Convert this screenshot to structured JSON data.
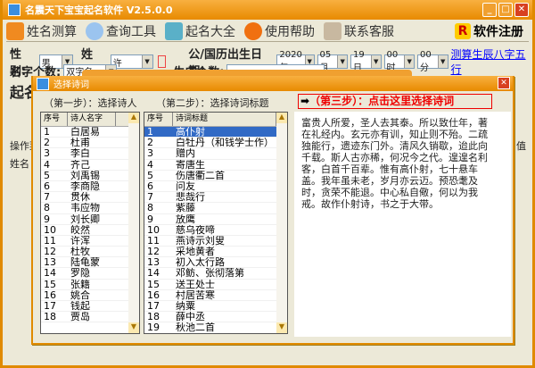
{
  "app": {
    "title": "名震天下宝宝起名软件 V2.5.0.0"
  },
  "toolbar": {
    "items": [
      "姓名测算",
      "查询工具",
      "起名大全",
      "使用帮助",
      "联系客服"
    ],
    "register": "软件注册"
  },
  "form": {
    "gender_label": "性别:",
    "gender": "男",
    "surname_label": "姓氏:",
    "surname": "许",
    "birth_label": "公/国历出生日期:",
    "year": "2020年",
    "month": "05月",
    "day": "19日",
    "hour": "00时",
    "minute": "00分",
    "bazi_link": "测算生辰八字五行",
    "count_label": "名字个数:",
    "count": "双字名",
    "gen_label": "生成个数:"
  },
  "background": {
    "heading": "起名",
    "menu": "操作菜",
    "col_name": "姓名",
    "col_value": "值"
  },
  "dialog": {
    "title": "选择诗词",
    "step1": "（第一步）：选择诗人",
    "step2": "（第二步）：选择诗词标题",
    "step3": "（第三步）：点击这里选择诗词",
    "poets_headers": [
      "序号",
      "诗人名字"
    ],
    "poets": [
      "白居易",
      "杜甫",
      "李白",
      "齐己",
      "刘禹锡",
      "李商隐",
      "贯休",
      "韦应物",
      "刘长卿",
      "皎然",
      "许浑",
      "杜牧",
      "陆龟蒙",
      "罗隐",
      "张籍",
      "姚合",
      "钱起",
      "贾岛"
    ],
    "titles_headers": [
      "序号",
      "诗词标题"
    ],
    "titles": [
      "高仆射",
      "白牡丹（和钱学士作）",
      "赠内",
      "寄唐生",
      "伤唐衢二首",
      "问友",
      "悲哉行",
      "紫藤",
      "放鹰",
      "慈乌夜啼",
      "燕诗示刘叟",
      "采地黄者",
      "初入太行路",
      "邓鲂、张彻落第",
      "送王处士",
      "村居苦寒",
      "纳粟",
      "薛中丞",
      "秋池二首",
      "夏旱"
    ],
    "selected_title_index": 0,
    "poem": "富贵人所爱，圣人去其泰。所以致仕年，著在礼经内。玄元亦有训，知止则不殆。二疏独能行，遗迹东门外。清风久销歇，迨此向千载。斯人古亦稀，何况今之代。遑遑名利客，白首千百辈。惟有高仆射，七十悬车盖。我年虽未老，岁月亦云迈。预恐耄及时，贪荣不能退。中心私自儆，何以为我戒。故作仆射诗，书之于大带。"
  }
}
